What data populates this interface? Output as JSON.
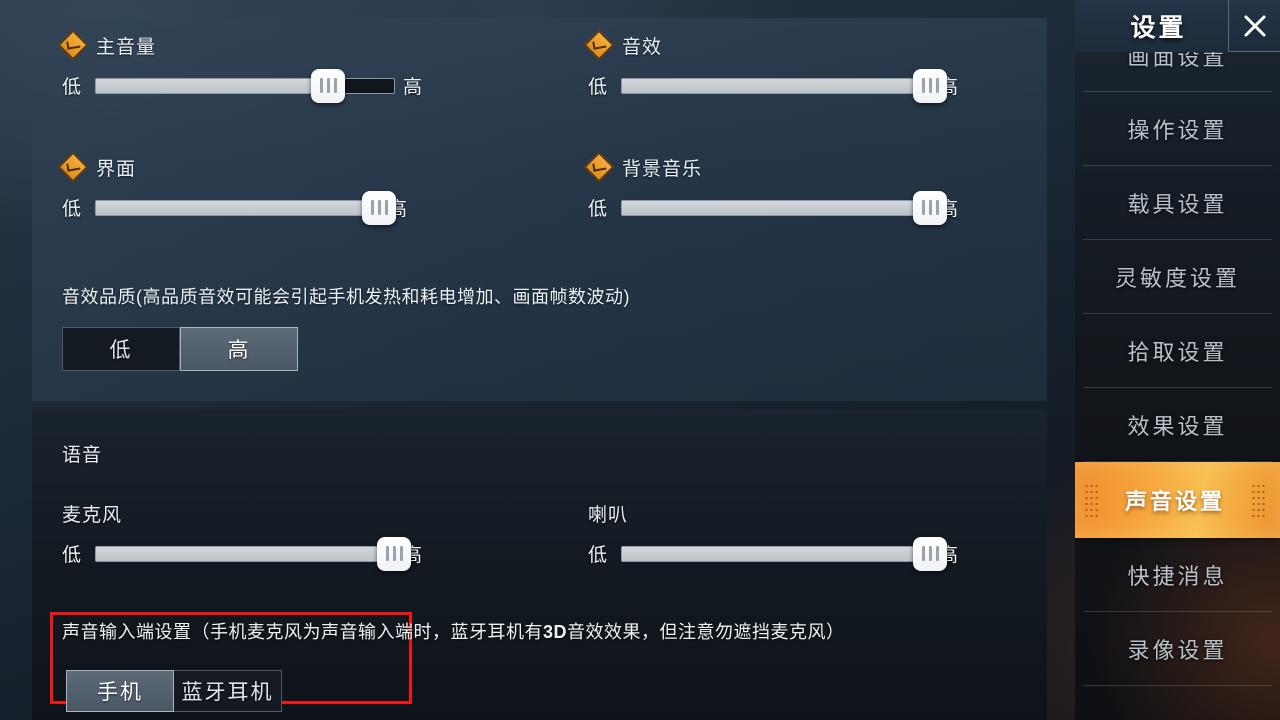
{
  "sidebar": {
    "title": "设置",
    "close_icon": "close-icon",
    "items": [
      {
        "label": "画面设置",
        "active": false,
        "clipped": true
      },
      {
        "label": "操作设置",
        "active": false
      },
      {
        "label": "载具设置",
        "active": false
      },
      {
        "label": "灵敏度设置",
        "active": false
      },
      {
        "label": "拾取设置",
        "active": false
      },
      {
        "label": "效果设置",
        "active": false
      },
      {
        "label": "声音设置",
        "active": true
      },
      {
        "label": "快捷消息",
        "active": false
      },
      {
        "label": "录像设置",
        "active": false
      }
    ],
    "accent_color": "#f5a23a"
  },
  "sliders": {
    "low_label": "低",
    "high_label": "高",
    "master_volume": {
      "label": "主音量",
      "checked": true,
      "value": 78
    },
    "sound_effects": {
      "label": "音效",
      "checked": true,
      "value": 100
    },
    "interface": {
      "label": "界面",
      "checked": true,
      "value": 100
    },
    "background_music": {
      "label": "背景音乐",
      "checked": true,
      "value": 100
    },
    "microphone": {
      "label": "麦克风",
      "checked": false,
      "value": 100
    },
    "speaker": {
      "label": "喇叭",
      "checked": false,
      "value": 100
    }
  },
  "quality": {
    "note": "音效品质(高品质音效可能会引起手机发热和耗电增加、画面帧数波动)",
    "options": [
      {
        "label": "低",
        "selected": false
      },
      {
        "label": "高",
        "selected": true
      }
    ]
  },
  "voice": {
    "title": "语音"
  },
  "input_source": {
    "note_part1": "声音输入端设置（手机麦克风为声音输入端时，蓝牙耳机有",
    "note_bold": "3D",
    "note_part2": "音效效果，但注意勿遮挡麦克风）",
    "options": [
      {
        "label": "手机",
        "selected": true
      },
      {
        "label": "蓝牙耳机",
        "selected": false
      }
    ],
    "highlight_color": "#f41616"
  }
}
